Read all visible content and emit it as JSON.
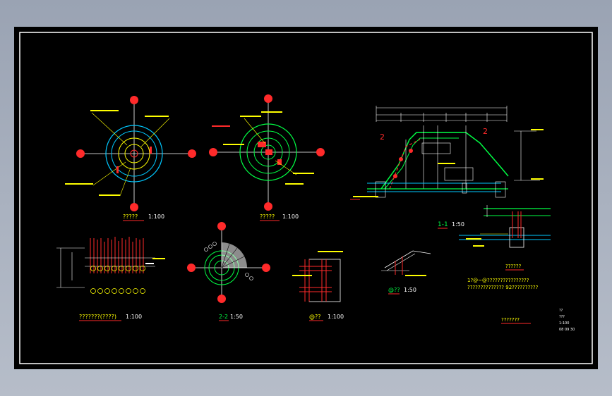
{
  "colors": {
    "background": "#000000",
    "frame": "#ffffff",
    "cyan": "#00c8ff",
    "green": "#00ff44",
    "yellow": "#ffff00",
    "red": "#ff2a2a",
    "white": "#ffffff"
  },
  "views": {
    "plan1": {
      "title": "?????",
      "scale": "1:100"
    },
    "plan2": {
      "title": "?????",
      "scale": "1:100"
    },
    "elevation": {
      "title": "???????(????)",
      "scale": "1:100"
    },
    "section22": {
      "title": "2-2",
      "scale": "1:50"
    },
    "detail_a": {
      "title": "@??",
      "scale": "1:100"
    },
    "section11": {
      "title": "1-1",
      "scale": "1:50"
    },
    "detail_b": {
      "title": "@??",
      "scale": "1:50"
    },
    "detail_c": {
      "title": "??????"
    }
  },
  "notes": {
    "line1": "1?@~@????????????????",
    "line2": "??????????????   92??????????",
    "footer_title": "???????",
    "legend": [
      "??",
      "???",
      "1:100",
      "08 09 30"
    ]
  }
}
